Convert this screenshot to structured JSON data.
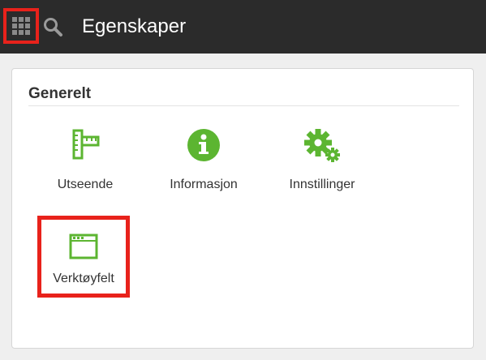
{
  "header": {
    "title": "Egenskaper",
    "background": "#2b2b2b",
    "apps_icon": "apps-grid-icon",
    "search_icon": "search-icon",
    "highlight_color": "#e8221b"
  },
  "section": {
    "title": "Generelt"
  },
  "items": [
    {
      "label": "Utseende",
      "icon": "ruler-square-icon"
    },
    {
      "label": "Informasjon",
      "icon": "info-circle-icon"
    },
    {
      "label": "Innstillinger",
      "icon": "gears-icon"
    },
    {
      "label": "Verktøyfelt",
      "icon": "toolbar-window-icon"
    }
  ],
  "colors": {
    "icon_green": "#5cb531",
    "text": "#333333"
  }
}
